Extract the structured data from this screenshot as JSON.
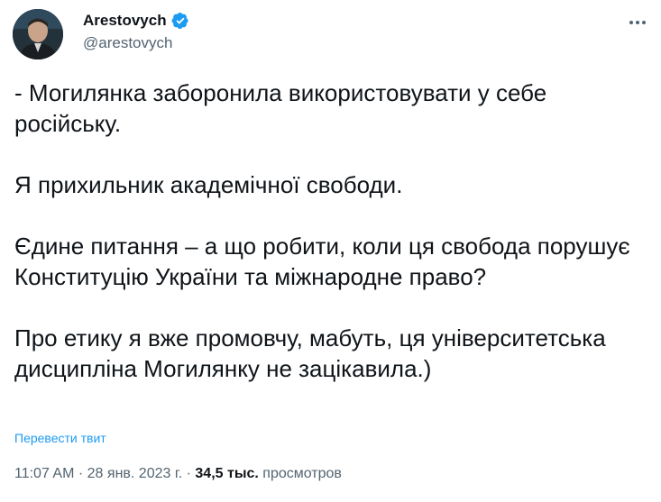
{
  "author": {
    "display_name": "Arestovych",
    "handle": "@arestovych",
    "verified": true,
    "verified_color": "#1d9bf0"
  },
  "tweet": {
    "paragraphs": [
      "- Могилянка заборонила використовувати у себе російську.",
      "Я прихильник академічної свободи.",
      "Єдине питання – а що робити, коли ця свобода порушує Конституцію України та міжнародне право?",
      "Про етику я вже промовчу, мабуть, ця університетська дисципліна Могилянку не зацікавила.)"
    ],
    "translate_label": "Перевести твит"
  },
  "meta": {
    "time": "11:07 AM",
    "separator": "·",
    "date": "28 янв. 2023 г.",
    "views_count": "34,5 тыс.",
    "views_label": "просмотров"
  },
  "icons": {
    "more": "more-horizontal-icon",
    "verified": "verified-badge-icon"
  },
  "colors": {
    "text": "#0f1419",
    "secondary": "#536471",
    "link": "#1d9bf0"
  }
}
